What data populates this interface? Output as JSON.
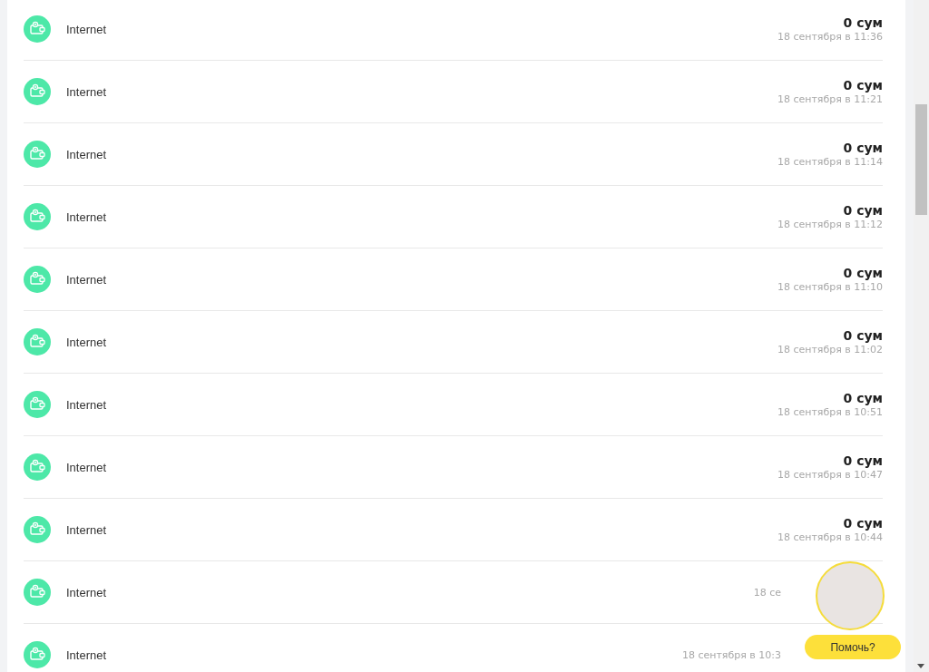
{
  "transactions": [
    {
      "name": "Internet",
      "amount": "0 сум",
      "date": "18 сентября в 11:36"
    },
    {
      "name": "Internet",
      "amount": "0 сум",
      "date": "18 сентября в 11:21"
    },
    {
      "name": "Internet",
      "amount": "0 сум",
      "date": "18 сентября в 11:14"
    },
    {
      "name": "Internet",
      "amount": "0 сум",
      "date": "18 сентября в 11:12"
    },
    {
      "name": "Internet",
      "amount": "0 сум",
      "date": "18 сентября в 11:10"
    },
    {
      "name": "Internet",
      "amount": "0 сум",
      "date": "18 сентября в 11:02"
    },
    {
      "name": "Internet",
      "amount": "0 сум",
      "date": "18 сентября в 10:51"
    },
    {
      "name": "Internet",
      "amount": "0 сум",
      "date": "18 сентября в 10:47"
    },
    {
      "name": "Internet",
      "amount": "0 сум",
      "date": "18 сентября в 10:44"
    },
    {
      "name": "Internet",
      "date": "18 се"
    },
    {
      "name": "Internet",
      "date": "18 сентября в 10:3"
    }
  ],
  "help_widget": {
    "button": "Помочь?"
  }
}
